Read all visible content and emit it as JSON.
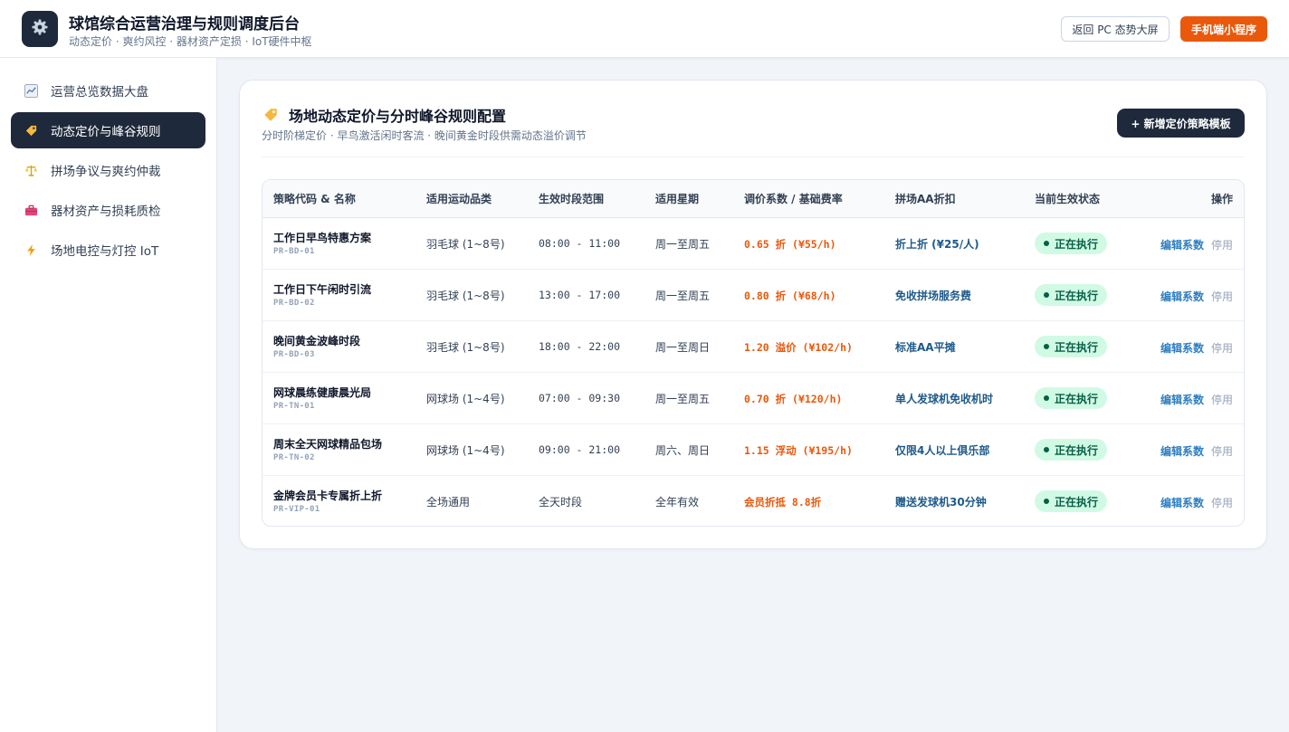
{
  "header": {
    "title": "球馆综合运营治理与规则调度后台",
    "subtitle": "动态定价 · 爽约风控 · 器材资产定损 · IoT硬件中枢",
    "back_button": "返回 PC 态势大屏",
    "mini_program_button": "手机端小程序"
  },
  "sidebar": {
    "items": [
      {
        "label": "运营总览数据大盘",
        "icon": "chart-icon",
        "active": false
      },
      {
        "label": "动态定价与峰谷规则",
        "icon": "tag-icon",
        "active": true
      },
      {
        "label": "拼场争议与爽约仲裁",
        "icon": "scales-icon",
        "active": false
      },
      {
        "label": "器材资产与损耗质检",
        "icon": "toolbox-icon",
        "active": false
      },
      {
        "label": "场地电控与灯控 IoT",
        "icon": "lightning-icon",
        "active": false
      }
    ]
  },
  "main": {
    "title": "场地动态定价与分时峰谷规则配置",
    "subtitle": "分时阶梯定价 · 早鸟激活闲时客流 · 晚间黄金时段供需动态溢价调节",
    "add_button": "+ 新增定价策略模板",
    "table": {
      "columns": [
        "策略代码 & 名称",
        "适用运动品类",
        "生效时段范围",
        "适用星期",
        "调价系数 / 基础费率",
        "拼场AA折扣",
        "当前生效状态",
        "操作"
      ],
      "rows": [
        {
          "name": "工作日早鸟特惠方案",
          "code": "PR-BD-01",
          "sport": "羽毛球 (1~8号)",
          "time": "08:00 - 11:00",
          "week": "周一至周五",
          "rate": "0.65 折 (¥55/h)",
          "aa": "折上折 (¥25/人)",
          "status": "正在执行",
          "edit": "编辑系数",
          "stop": "停用"
        },
        {
          "name": "工作日下午闲时引流",
          "code": "PR-BD-02",
          "sport": "羽毛球 (1~8号)",
          "time": "13:00 - 17:00",
          "week": "周一至周五",
          "rate": "0.80 折 (¥68/h)",
          "aa": "免收拼场服务费",
          "status": "正在执行",
          "edit": "编辑系数",
          "stop": "停用"
        },
        {
          "name": "晚间黄金波峰时段",
          "code": "PR-BD-03",
          "sport": "羽毛球 (1~8号)",
          "time": "18:00 - 22:00",
          "week": "周一至周日",
          "rate": "1.20 溢价 (¥102/h)",
          "aa": "标准AA平摊",
          "status": "正在执行",
          "edit": "编辑系数",
          "stop": "停用"
        },
        {
          "name": "网球晨练健康晨光局",
          "code": "PR-TN-01",
          "sport": "网球场 (1~4号)",
          "time": "07:00 - 09:30",
          "week": "周一至周五",
          "rate": "0.70 折 (¥120/h)",
          "aa": "单人发球机免收机时",
          "status": "正在执行",
          "edit": "编辑系数",
          "stop": "停用"
        },
        {
          "name": "周末全天网球精品包场",
          "code": "PR-TN-02",
          "sport": "网球场 (1~4号)",
          "time": "09:00 - 21:00",
          "week": "周六、周日",
          "rate": "1.15 浮动 (¥195/h)",
          "aa": "仅限4人以上俱乐部",
          "status": "正在执行",
          "edit": "编辑系数",
          "stop": "停用"
        },
        {
          "name": "金牌会员卡专属折上折",
          "code": "PR-VIP-01",
          "sport": "全场通用",
          "time": "全天时段",
          "week": "全年有效",
          "rate": "会员折抵 8.8折",
          "aa": "赠送发球机30分钟",
          "status": "正在执行",
          "edit": "编辑系数",
          "stop": "停用"
        }
      ]
    }
  },
  "colors": {
    "accent_orange": "#ea580c",
    "dark": "#1e293b",
    "status_bg": "#d1fae5",
    "status_text": "#065f46",
    "link_blue": "#2f7fc1"
  }
}
